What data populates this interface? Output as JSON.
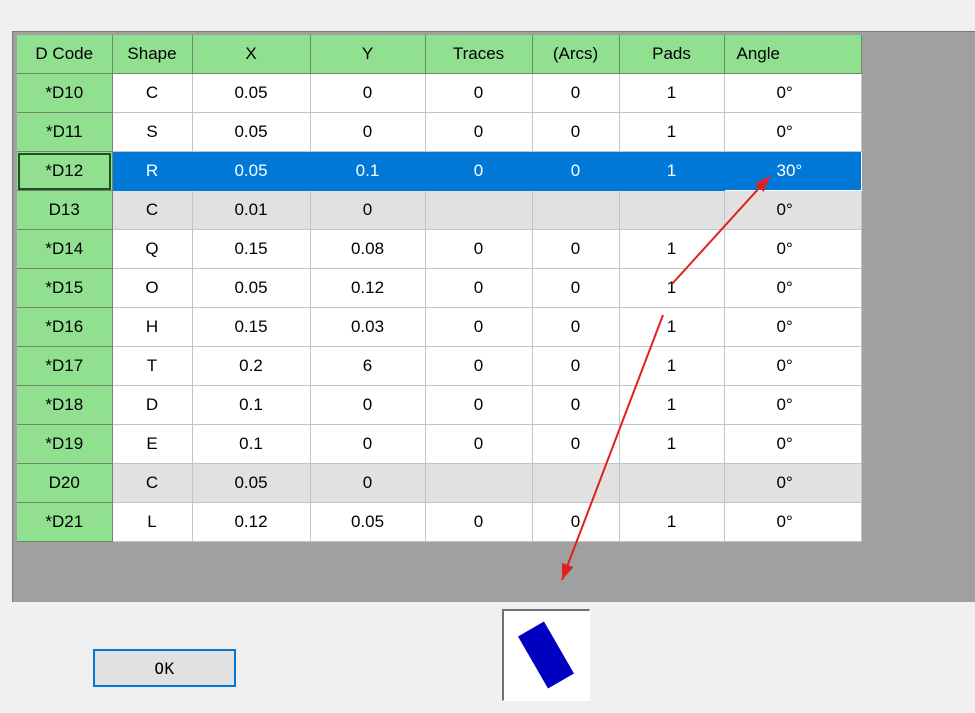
{
  "columns": [
    "D Code",
    "Shape",
    "X",
    "Y",
    "Traces",
    "(Arcs)",
    "Pads",
    "Angle"
  ],
  "rows": [
    {
      "dcode": "*D10",
      "shape": "C",
      "x": "0.05",
      "y": "0",
      "traces": "0",
      "arcs": "0",
      "pads": "1",
      "angle": "0°",
      "state": "normal"
    },
    {
      "dcode": "*D11",
      "shape": "S",
      "x": "0.05",
      "y": "0",
      "traces": "0",
      "arcs": "0",
      "pads": "1",
      "angle": "0°",
      "state": "normal"
    },
    {
      "dcode": "*D12",
      "shape": "R",
      "x": "0.05",
      "y": "0.1",
      "traces": "0",
      "arcs": "0",
      "pads": "1",
      "angle": "30°",
      "state": "selected"
    },
    {
      "dcode": "D13",
      "shape": "C",
      "x": "0.01",
      "y": "0",
      "traces": "",
      "arcs": "",
      "pads": "",
      "angle": "0°",
      "state": "inactive"
    },
    {
      "dcode": "*D14",
      "shape": "Q",
      "x": "0.15",
      "y": "0.08",
      "traces": "0",
      "arcs": "0",
      "pads": "1",
      "angle": "0°",
      "state": "normal"
    },
    {
      "dcode": "*D15",
      "shape": "O",
      "x": "0.05",
      "y": "0.12",
      "traces": "0",
      "arcs": "0",
      "pads": "1",
      "angle": "0°",
      "state": "normal"
    },
    {
      "dcode": "*D16",
      "shape": "H",
      "x": "0.15",
      "y": "0.03",
      "traces": "0",
      "arcs": "0",
      "pads": "1",
      "angle": "0°",
      "state": "normal"
    },
    {
      "dcode": "*D17",
      "shape": "T",
      "x": "0.2",
      "y": "6",
      "traces": "0",
      "arcs": "0",
      "pads": "1",
      "angle": "0°",
      "state": "normal"
    },
    {
      "dcode": "*D18",
      "shape": "D",
      "x": "0.1",
      "y": "0",
      "traces": "0",
      "arcs": "0",
      "pads": "1",
      "angle": "0°",
      "state": "normal"
    },
    {
      "dcode": "*D19",
      "shape": "E",
      "x": "0.1",
      "y": "0",
      "traces": "0",
      "arcs": "0",
      "pads": "1",
      "angle": "0°",
      "state": "normal"
    },
    {
      "dcode": "D20",
      "shape": "C",
      "x": "0.05",
      "y": "0",
      "traces": "",
      "arcs": "",
      "pads": "",
      "angle": "0°",
      "state": "inactive"
    },
    {
      "dcode": "*D21",
      "shape": "L",
      "x": "0.12",
      "y": "0.05",
      "traces": "0",
      "arcs": "0",
      "pads": "1",
      "angle": "0°",
      "state": "normal"
    }
  ],
  "ok_label": "OK",
  "preview": {
    "shape": "R",
    "angle_deg": 30,
    "fill_color": "#0000c0"
  },
  "annotation_color": "#e02020",
  "colors": {
    "header_bg": "#90e090",
    "selected_bg": "#0078d7",
    "inactive_bg": "#e1e1e1"
  }
}
